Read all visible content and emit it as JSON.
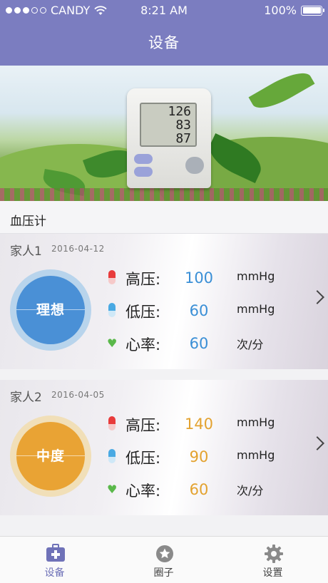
{
  "status_bar": {
    "carrier": "CANDY",
    "time": "8:21 AM",
    "battery": "100%"
  },
  "nav": {
    "title": "设备"
  },
  "banner": {
    "device_readings": [
      "126",
      "83",
      "87"
    ]
  },
  "section": {
    "title": "血压计"
  },
  "cards": [
    {
      "name": "家人1",
      "date": "2016-04-12",
      "status_label": "理想",
      "status_color": "#4a90d6",
      "systolic": {
        "label": "高压:",
        "value": "100",
        "unit": "mmHg"
      },
      "diastolic": {
        "label": "低压:",
        "value": "60",
        "unit": "mmHg"
      },
      "heart_rate": {
        "label": "心率:",
        "value": "60",
        "unit": "次/分"
      }
    },
    {
      "name": "家人2",
      "date": "2016-04-05",
      "status_label": "中度",
      "status_color": "#e9a334",
      "systolic": {
        "label": "高压:",
        "value": "140",
        "unit": "mmHg"
      },
      "diastolic": {
        "label": "低压:",
        "value": "90",
        "unit": "mmHg"
      },
      "heart_rate": {
        "label": "心率:",
        "value": "60",
        "unit": "次/分"
      }
    }
  ],
  "tabbar": {
    "items": [
      {
        "label": "设备",
        "icon": "medical-kit-icon",
        "active": true
      },
      {
        "label": "圈子",
        "icon": "star-circle-icon",
        "active": false
      },
      {
        "label": "设置",
        "icon": "gear-icon",
        "active": false
      }
    ],
    "active_color": "#6f72b8"
  }
}
